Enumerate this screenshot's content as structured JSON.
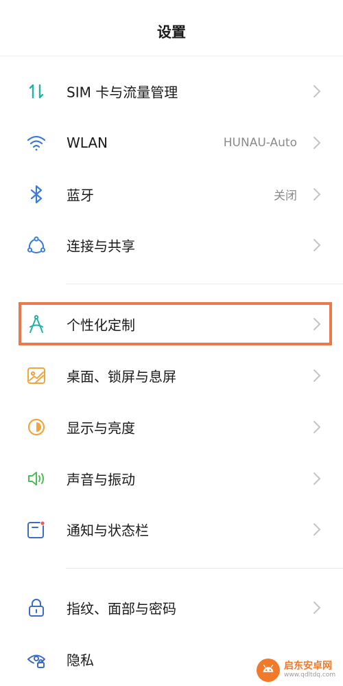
{
  "header": {
    "title": "设置"
  },
  "colors": {
    "icon_teal": "#21b3a0",
    "icon_blue": "#3b7bd8",
    "icon_orange": "#f3a43a",
    "icon_green": "#4cbc55",
    "icon_navy": "#3e6bc8",
    "notify_red": "#f05b4b",
    "highlight": "#e9784c",
    "chevron": "#c4c4c4",
    "value_text": "#8a8a8a"
  },
  "settings": {
    "items": [
      {
        "label": "SIM 卡与流量管理",
        "value": "",
        "icon": "sim-data-icon"
      },
      {
        "label": "WLAN",
        "value": "HUNAU-Auto",
        "icon": "wifi-icon"
      },
      {
        "label": "蓝牙",
        "value": "关闭",
        "icon": "bluetooth-icon"
      },
      {
        "label": "连接与共享",
        "value": "",
        "icon": "connection-share-icon"
      },
      {
        "label": "个性化定制",
        "value": "",
        "icon": "personalization-icon"
      },
      {
        "label": "桌面、锁屏与息屏",
        "value": "",
        "icon": "wallpaper-icon"
      },
      {
        "label": "显示与亮度",
        "value": "",
        "icon": "brightness-icon"
      },
      {
        "label": "声音与振动",
        "value": "",
        "icon": "sound-icon"
      },
      {
        "label": "通知与状态栏",
        "value": "",
        "icon": "notification-icon"
      },
      {
        "label": "指纹、面部与密码",
        "value": "",
        "icon": "lock-icon"
      },
      {
        "label": "隐私",
        "value": "",
        "icon": "privacy-icon"
      }
    ]
  },
  "watermark": {
    "name": "启东安卓网",
    "url": "www.qdltdq.com"
  }
}
